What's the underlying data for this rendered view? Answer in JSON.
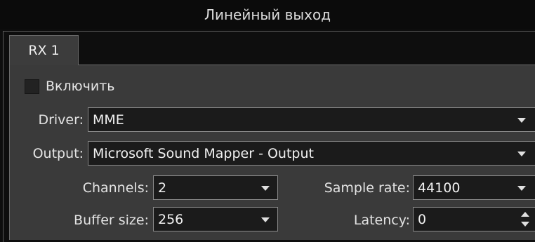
{
  "window": {
    "title": "Линейный выход"
  },
  "tabs": [
    {
      "label": "RX 1",
      "active": true
    }
  ],
  "enable": {
    "label": "Включить",
    "checked": false
  },
  "driver": {
    "label": "Driver:",
    "value": "MME"
  },
  "output": {
    "label": "Output:",
    "value": "Microsoft Sound Mapper - Output"
  },
  "channels": {
    "label": "Channels:",
    "value": "2"
  },
  "sample_rate": {
    "label": "Sample rate:",
    "value": "44100"
  },
  "buffer_size": {
    "label": "Buffer size:",
    "value": "256"
  },
  "latency": {
    "label": "Latency:",
    "value": "0"
  },
  "colors": {
    "background": "#0e0e0e",
    "panel": "#3a3a3a",
    "field": "#1b1b1b",
    "field_border": "#8a8a8a",
    "text": "#e6e6e6"
  },
  "icons": {
    "dropdown": "chevron-down-icon",
    "spinner": "spin-arrows-icon"
  }
}
